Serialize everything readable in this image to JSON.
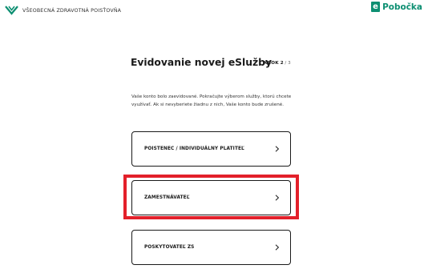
{
  "header": {
    "logo_icon": "vszp-chevron-logo",
    "logo_text": "VŠEOBECNÁ ZDRAVOTNÁ POISŤOVŇA",
    "branch_icon_letter": "e",
    "branch_text": "Pobočka",
    "brand_color": "#0d8f72"
  },
  "main": {
    "title": "Evidovanie novej eSlužby",
    "step": {
      "label": "KROK",
      "current": "2",
      "separator": " / ",
      "total": "3"
    },
    "info": "Vaše konto bolo zaevidované. Pokračujte výberom služby, ktorú chcete využívať. Ak si nevyberiete žiadnu z nich, Vaše konto bude zrušené.",
    "options": [
      {
        "label": "POISTENEC / INDIVIDUÁLNY PLATITEĽ",
        "icon": "chevron-right-icon"
      },
      {
        "label": "ZAMESTNÁVATEĽ",
        "icon": "chevron-right-icon"
      },
      {
        "label": "POSKYTOVATEĽ ZS",
        "icon": "chevron-right-icon"
      }
    ]
  },
  "highlight_color": "#e3202a"
}
